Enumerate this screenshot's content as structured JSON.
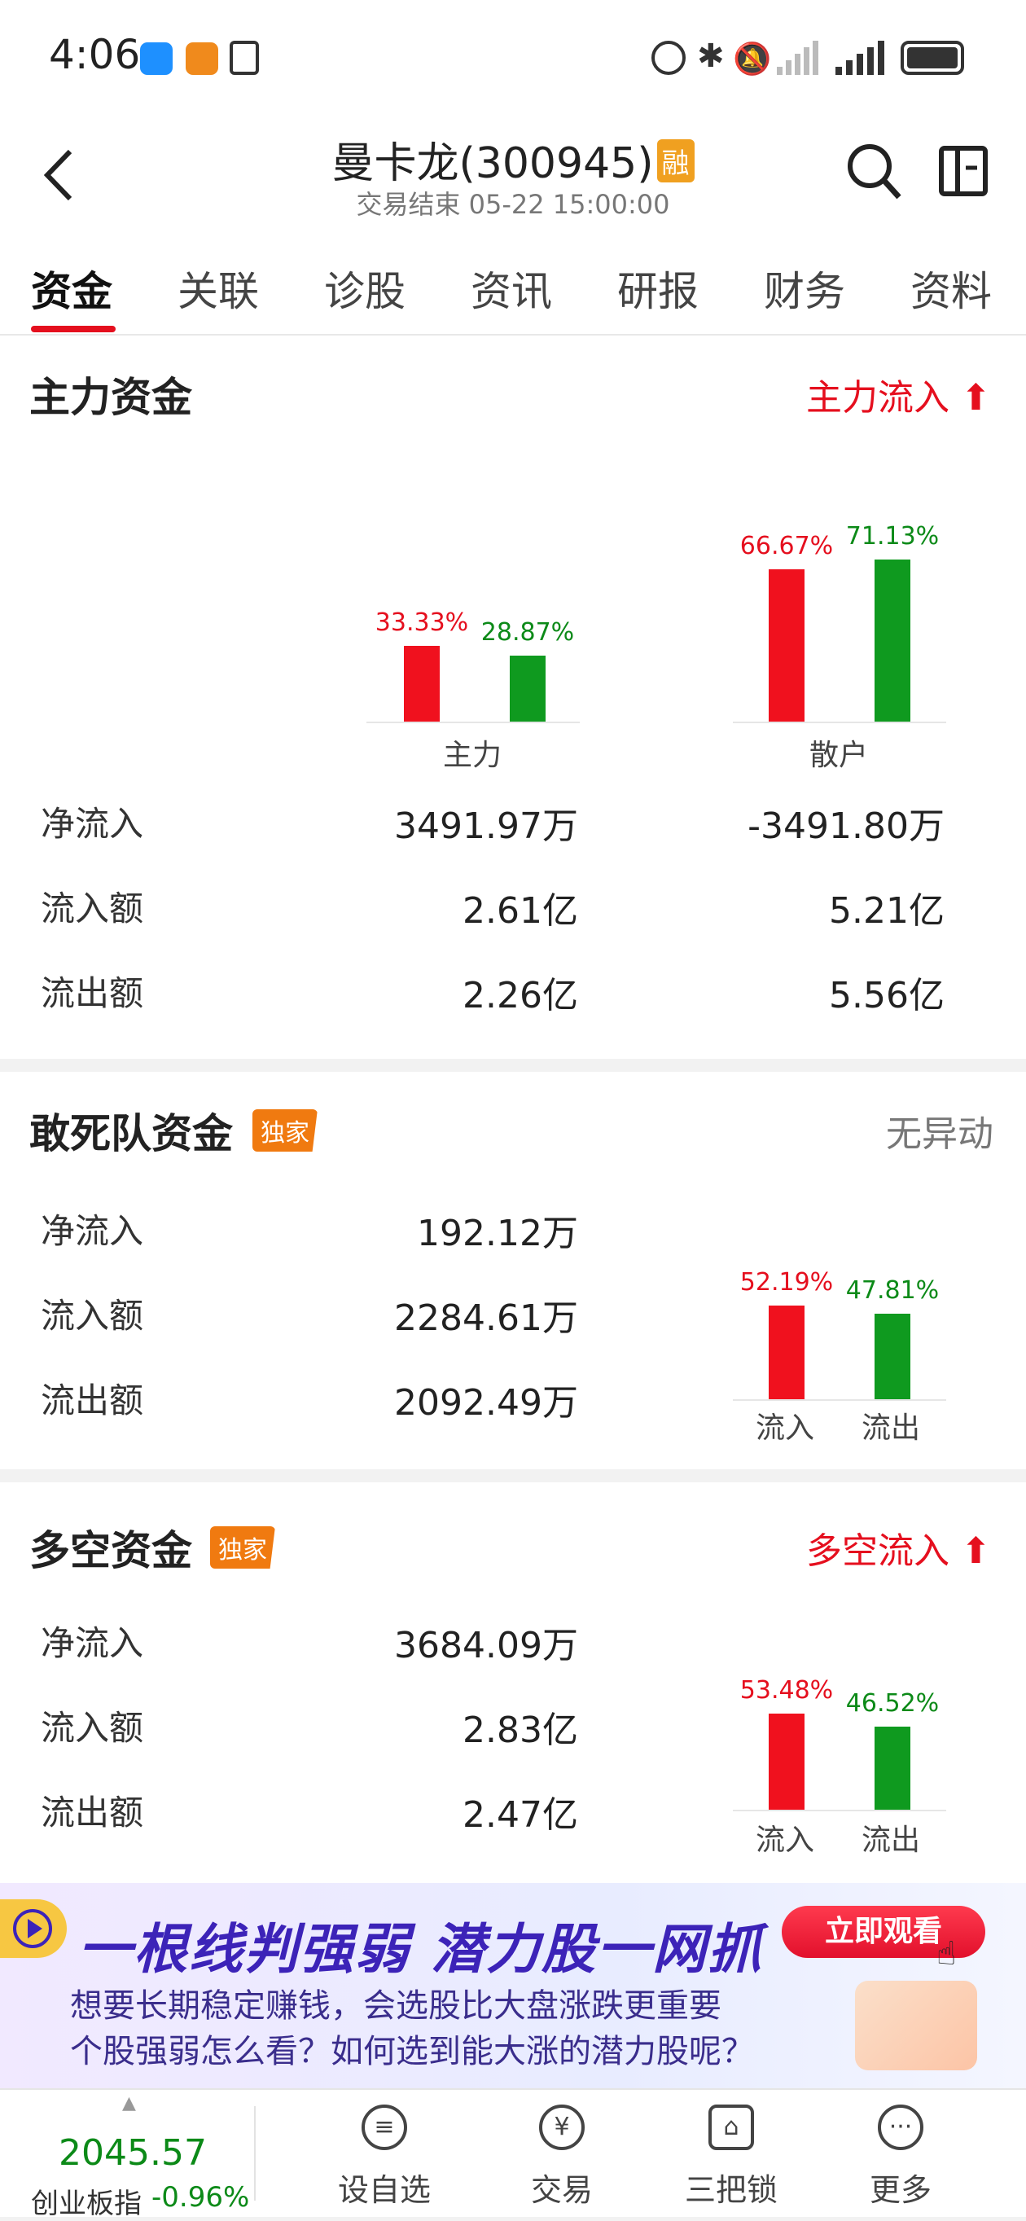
{
  "status_bar": {
    "time": "4:06"
  },
  "header": {
    "stock_name": "曼卡龙(300945)",
    "margin_badge": "融",
    "subtitle": "交易结束 05-22 15:00:00"
  },
  "tabs": [
    "资金",
    "关联",
    "诊股",
    "资讯",
    "研报",
    "财务",
    "资料"
  ],
  "main_funds": {
    "title": "主力资金",
    "status": "主力流入",
    "groups": [
      {
        "name": "主力",
        "in_pct": "33.33%",
        "out_pct": "28.87%",
        "in_value": 0.3333,
        "out_value": 0.2887
      },
      {
        "name": "散户",
        "in_pct": "66.67%",
        "out_pct": "71.13%",
        "in_value": 0.6667,
        "out_value": 0.7113
      }
    ],
    "rows": [
      {
        "label": "净流入",
        "main": "3491.97万",
        "retail": "-3491.80万"
      },
      {
        "label": "流入额",
        "main": "2.61亿",
        "retail": "5.21亿"
      },
      {
        "label": "流出额",
        "main": "2.26亿",
        "retail": "5.56亿"
      }
    ]
  },
  "dare_funds": {
    "title": "敢死队资金",
    "badge": "独家",
    "status": "无异动",
    "rows": [
      {
        "label": "净流入",
        "value": "192.12万"
      },
      {
        "label": "流入额",
        "value": "2284.61万"
      },
      {
        "label": "流出额",
        "value": "2092.49万"
      }
    ],
    "chart": {
      "in_pct": "52.19%",
      "out_pct": "47.81%",
      "in_value": 0.5219,
      "out_value": 0.4781,
      "in_label": "流入",
      "out_label": "流出"
    }
  },
  "longshort_funds": {
    "title": "多空资金",
    "badge": "独家",
    "status": "多空流入",
    "rows": [
      {
        "label": "净流入",
        "value": "3684.09万"
      },
      {
        "label": "流入额",
        "value": "2.83亿"
      },
      {
        "label": "流出额",
        "value": "2.47亿"
      }
    ],
    "chart": {
      "in_pct": "53.48%",
      "out_pct": "46.52%",
      "in_value": 0.5348,
      "out_value": 0.4652,
      "in_label": "流入",
      "out_label": "流出"
    }
  },
  "banner": {
    "title": "一根线判强弱 潜力股一网抓",
    "button": "立即观看",
    "line1": "想要长期稳定赚钱，会选股比大盘涨跌更重要",
    "line2": "个股强弱怎么看？如何选到能大涨的潜力股呢？"
  },
  "bottom_nav": {
    "index_value": "2045.57",
    "index_name": "创业板指",
    "index_change": "-0.96%",
    "items": [
      {
        "label": "设自选",
        "icon": "list-icon"
      },
      {
        "label": "交易",
        "icon": "yen-icon"
      },
      {
        "label": "三把锁",
        "icon": "lock-icon"
      },
      {
        "label": "更多",
        "icon": "more-icon"
      }
    ]
  },
  "colors": {
    "red": "#e50f1e",
    "green": "#0c8a18",
    "badge": "#f07a10"
  }
}
